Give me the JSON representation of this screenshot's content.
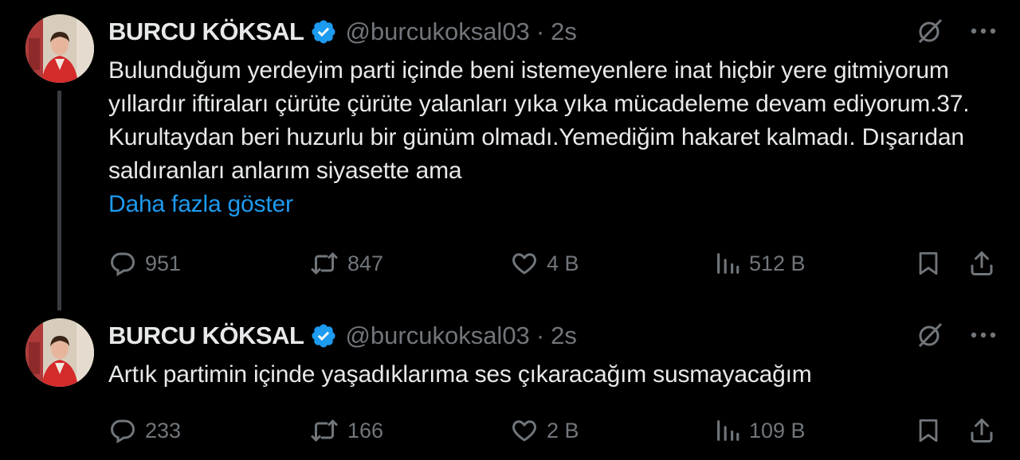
{
  "colors": {
    "background": "#000000",
    "text": "#e7e9ea",
    "muted": "#71767b",
    "link": "#1d9bf0",
    "verified": "#1d9bf0",
    "thread_line": "#3a3d40"
  },
  "tweets": [
    {
      "author_name": "BURCU KÖKSAL",
      "handle": "@burcukoksal03",
      "separator": "·",
      "time": "2s",
      "text": "Bulunduğum yerdeyim parti içinde beni istemeyenlere inat hiçbir yere gitmiyorum yıllardır iftiraları çürüte çürüte yalanları yıka yıka mücadeleme devam ediyorum.37. Kurultaydan beri huzurlu bir günüm olmadı.Yemediğim hakaret kalmadı. Dışarıdan saldıranları anlarım siyasette ama",
      "show_more": "Daha fazla göster",
      "replies": "951",
      "retweets": "847",
      "likes": "4 B",
      "views": "512 B"
    },
    {
      "author_name": "BURCU KÖKSAL",
      "handle": "@burcukoksal03",
      "separator": "·",
      "time": "2s",
      "text": "Artık partimin içinde yaşadıklarıma ses çıkaracağım susmayacağım",
      "replies": "233",
      "retweets": "166",
      "likes": "2 B",
      "views": "109 B"
    }
  ],
  "icons": {
    "verified": "verified-badge-icon",
    "grok": "slashed-circle-icon",
    "more": "more-dots-icon",
    "reply": "reply-bubble-icon",
    "retweet": "retweet-icon",
    "like": "heart-icon",
    "views": "views-bar-icon",
    "bookmark": "bookmark-icon",
    "share": "share-icon"
  }
}
